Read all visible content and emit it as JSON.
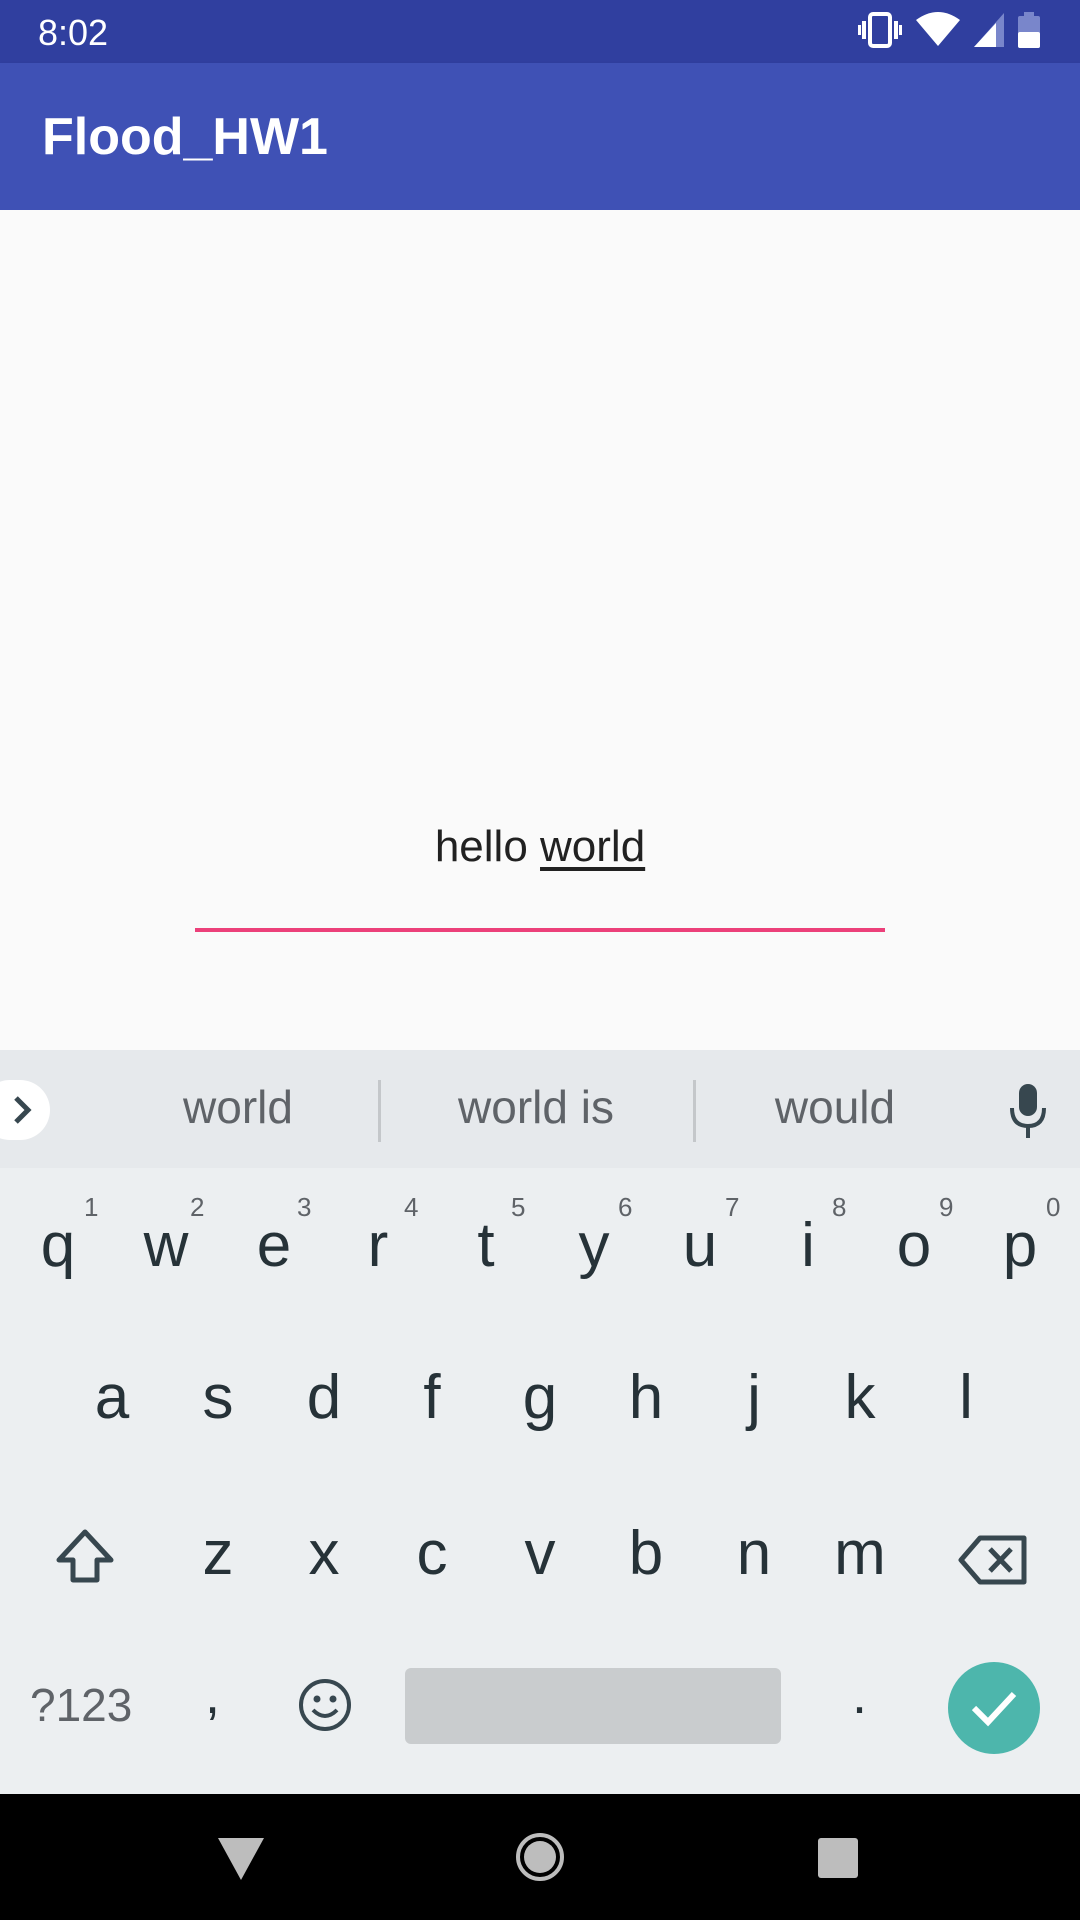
{
  "status_bar": {
    "time": "8:02",
    "icons": [
      "vibrate-icon",
      "wifi-icon",
      "cell-signal-icon",
      "battery-icon"
    ]
  },
  "app_bar": {
    "title": "Flood_HW1",
    "color": "#3f51b5"
  },
  "edit_text": {
    "value_plain": "hello ",
    "value_composing": "world",
    "underline_color": "#ec407a"
  },
  "keyboard": {
    "suggestions": [
      "world",
      "world is",
      "would"
    ],
    "row1": [
      "q",
      "w",
      "e",
      "r",
      "t",
      "y",
      "u",
      "i",
      "o",
      "p"
    ],
    "row1_hints": [
      "1",
      "2",
      "3",
      "4",
      "5",
      "6",
      "7",
      "8",
      "9",
      "0"
    ],
    "row2": [
      "a",
      "s",
      "d",
      "f",
      "g",
      "h",
      "j",
      "k",
      "l"
    ],
    "row3": [
      "z",
      "x",
      "c",
      "v",
      "b",
      "n",
      "m"
    ],
    "symbols_label": "?123",
    "comma_label": ",",
    "period_label": ".",
    "enter_color": "#4db6ac"
  },
  "nav_bar": {
    "icons": [
      "back-icon",
      "home-icon",
      "recents-icon"
    ]
  }
}
